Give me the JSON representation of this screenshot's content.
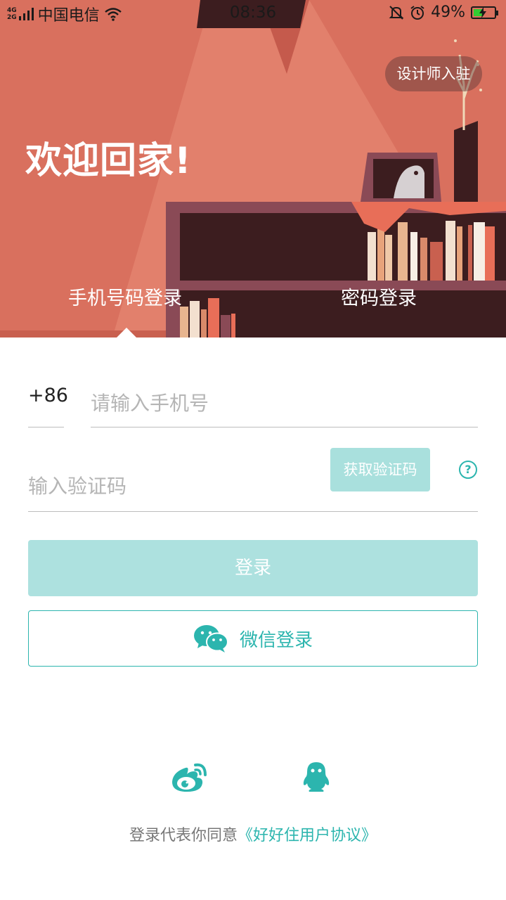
{
  "status_bar": {
    "network_top": "4G",
    "network_bottom": "2G",
    "carrier": "中国电信",
    "time": "08:36",
    "battery": "49%",
    "battery_level": 0.49
  },
  "header": {
    "designer_button": "设计师入驻",
    "welcome": "欢迎回家!",
    "tabs": [
      {
        "label": "手机号码登录",
        "active": true
      },
      {
        "label": "密码登录",
        "active": false
      }
    ]
  },
  "form": {
    "country_code": "+86",
    "phone_placeholder": "请输入手机号",
    "code_placeholder": "输入验证码",
    "get_code_button": "获取验证码",
    "help_symbol": "?",
    "login_button": "登录",
    "wechat_button": "微信登录"
  },
  "social": {
    "icons": [
      "weibo-icon",
      "qq-icon"
    ]
  },
  "agreement": {
    "prefix": "登录代表你同意",
    "link": "《好好住用户协议》"
  },
  "colors": {
    "accent": "#2cb5ae",
    "accent_light": "#ade1df",
    "header_bg": "#d9705e"
  }
}
